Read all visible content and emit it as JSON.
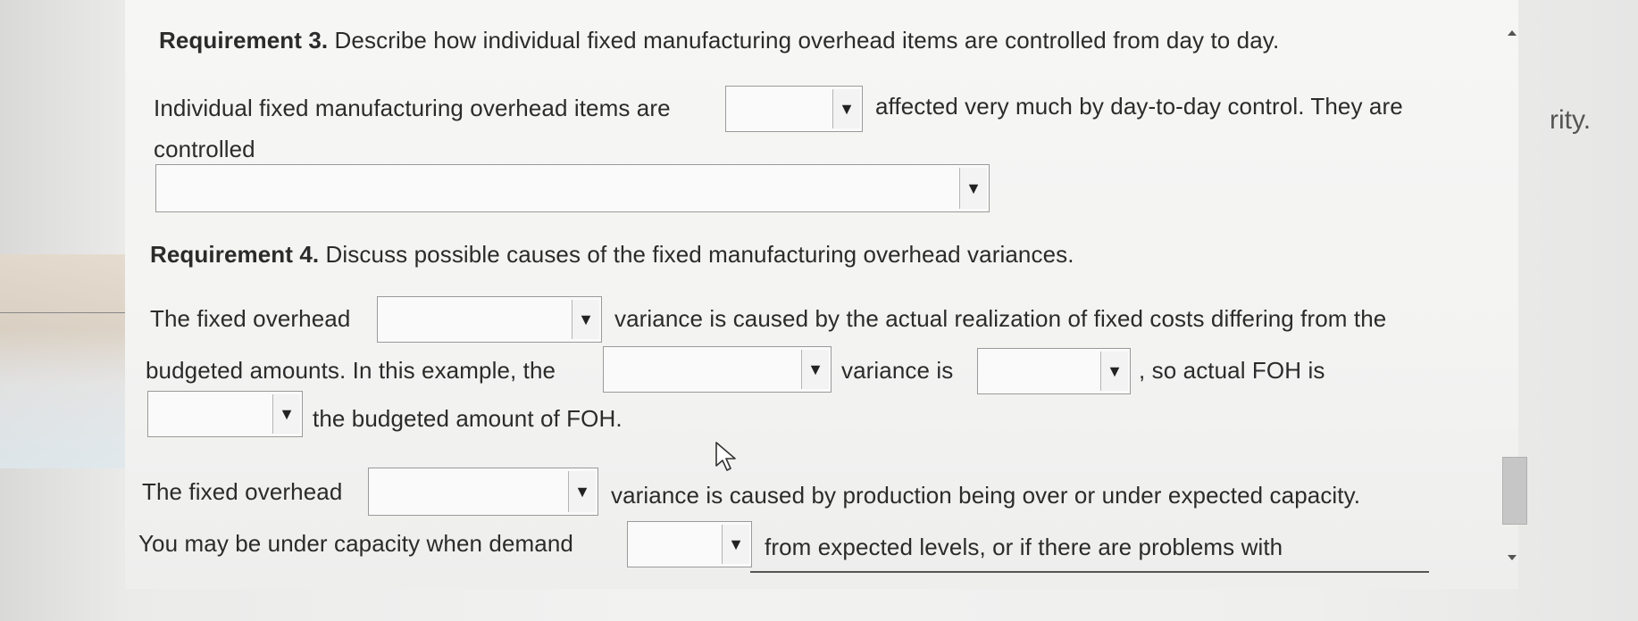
{
  "req3": {
    "label": "Requirement 3.",
    "text": " Describe how individual fixed manufacturing overhead items are controlled from day to day.",
    "line1_before": "Individual fixed manufacturing overhead items are",
    "line1_after": "affected very much by day-to-day control. They are",
    "line2": "controlled"
  },
  "req4": {
    "label": "Requirement 4.",
    "text": " Discuss possible causes of the fixed manufacturing overhead variances.",
    "p1_before": "The fixed overhead",
    "p1_after": "variance is caused by the actual realization of fixed costs differing from the",
    "p2_before": "budgeted amounts. In this example, the",
    "p2_mid": "variance is",
    "p2_after": ", so actual FOH is",
    "p3_after": "the budgeted amount of FOH.",
    "q1_before": "The fixed overhead",
    "q1_after": "variance is caused by production being over or under expected capacity.",
    "q2_before": "You may be under capacity when demand",
    "q2_after": "from expected levels, or if there are problems with"
  },
  "dropdowns": {
    "arrow": "▼",
    "selected": ""
  },
  "side": {
    "text": "rity."
  },
  "icons": {
    "dropdown": "dropdown-arrow-icon",
    "cursor": "mouse-pointer-icon"
  },
  "colors": {
    "text": "#2b2b2b",
    "border": "#9a9a9a",
    "background": "#f3f3f2"
  }
}
